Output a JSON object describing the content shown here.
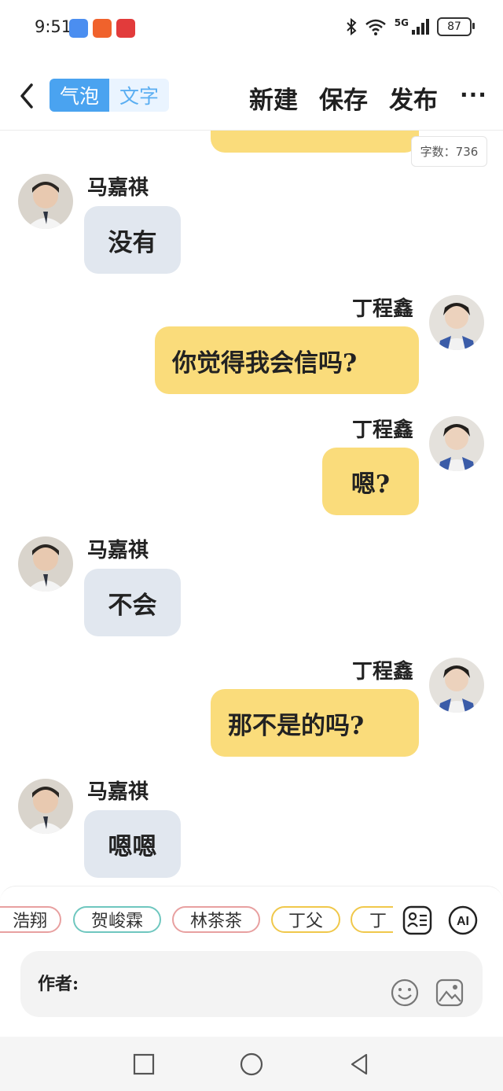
{
  "status_bar": {
    "time": "9:51",
    "network": "5G",
    "battery": "87"
  },
  "header": {
    "tab_bubble": "气泡",
    "tab_text": "文字",
    "new": "新建",
    "save": "保存",
    "publish": "发布",
    "more": "···"
  },
  "word_count": "字数：736",
  "messages": [
    {
      "side": "left",
      "name": "马嘉祺",
      "text": "没有"
    },
    {
      "side": "right",
      "name": "丁程鑫",
      "text": "你觉得我会信吗?"
    },
    {
      "side": "right",
      "name": "丁程鑫",
      "text": "嗯?"
    },
    {
      "side": "left",
      "name": "马嘉祺",
      "text": "不会"
    },
    {
      "side": "right",
      "name": "丁程鑫",
      "text": "那不是的吗?"
    },
    {
      "side": "left",
      "name": "马嘉祺",
      "text": "嗯嗯"
    }
  ],
  "chips": [
    "浩翔",
    "贺峻霖",
    "林茶茶",
    "丁父",
    "丁"
  ],
  "chip_colors": [
    "#e8a0a0",
    "#6fc7bf",
    "#e8a0a0",
    "#f0c84b",
    "#f0c84b"
  ],
  "input": {
    "label": "作者:"
  },
  "colors": {
    "accent": "#4aa3f0",
    "left_bubble": "#e1e7ef",
    "right_bubble": "#fadc7b"
  }
}
